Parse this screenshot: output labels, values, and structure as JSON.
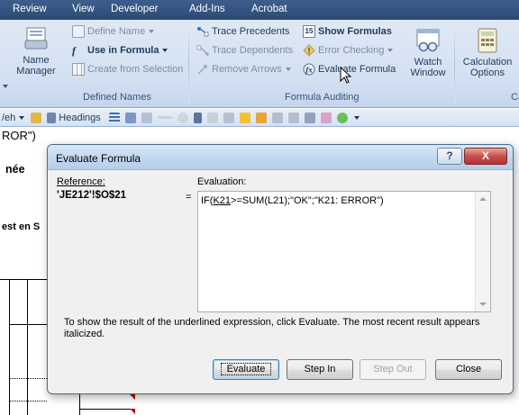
{
  "ribbon_tabs": [
    "Review",
    "View",
    "Developer",
    "Add-Ins",
    "Acrobat"
  ],
  "defined_names": {
    "name_manager_line1": "Name",
    "name_manager_line2": "Manager",
    "define_name": "Define Name",
    "use_in_formula": "Use in Formula",
    "create_from_selection": "Create from Selection",
    "group_label": "Defined Names"
  },
  "formula_auditing": {
    "trace_precedents": "Trace Precedents",
    "trace_dependents": "Trace Dependents",
    "remove_arrows": "Remove Arrows",
    "show_formulas": "Show Formulas",
    "error_checking": "Error Checking",
    "evaluate_formula": "Evaluate Formula",
    "group_label": "Formula Auditing"
  },
  "watch_window": {
    "line1": "Watch",
    "line2": "Window"
  },
  "calculation": {
    "line1": "Calculation",
    "line2": "Options",
    "group_label_partial": "Ca"
  },
  "toolbar": {
    "left_text": "/eh",
    "headings_label": "Headings"
  },
  "sheet": {
    "formula_fragment": "ROR\")",
    "cell_nee": "née",
    "cell_est": "est en S"
  },
  "dialog": {
    "title": "Evaluate Formula",
    "help_glyph": "?",
    "close_glyph": "X",
    "reference_label": "Reference:",
    "reference_value": "'JE212'!$O$21",
    "equals": "=",
    "evaluation_label": "Evaluation:",
    "evaluation_prefix": "IF(",
    "evaluation_underlined": "K21",
    "evaluation_suffix": ">=SUM(L21);\"OK\";\"K21: ERROR\")",
    "hint": "To show the result of the underlined expression, click Evaluate.  The most recent result appears italicized.",
    "buttons": {
      "evaluate": "Evaluate",
      "step_in": "Step In",
      "step_out": "Step Out",
      "close": "Close"
    }
  },
  "colors": {
    "tab_bar": "#2c4a75",
    "ribbon": "#d3e0f1",
    "dialog_bg": "#f0f0f0",
    "close_red": "#c75050"
  }
}
